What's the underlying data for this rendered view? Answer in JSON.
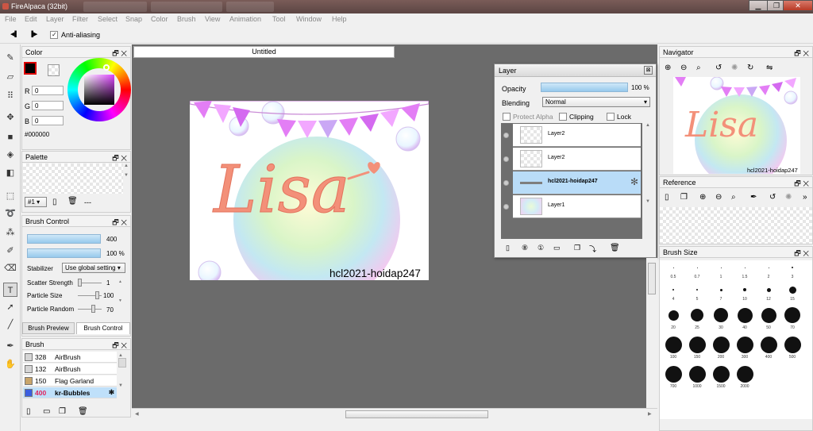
{
  "titlebar": {
    "app_title": "FireAlpaca (32bit)",
    "minimize": "▁",
    "maximize": "❐",
    "close": "✕"
  },
  "menu": [
    "File",
    "Edit",
    "Layer",
    "Filter",
    "Select",
    "Snap",
    "Color",
    "Brush",
    "View",
    "Animation",
    "Tool",
    "Window",
    "Help"
  ],
  "tool_options": {
    "prev_glyph": "◀▌",
    "next_glyph": "▐▶",
    "anti_aliasing_label": "Anti-aliasing",
    "anti_aliasing_checked": true
  },
  "tools": [
    {
      "name": "pen-tool-icon",
      "glyph": "✎"
    },
    {
      "name": "eraser-tool-icon",
      "glyph": "▱"
    },
    {
      "name": "dot-tool-icon",
      "glyph": "⠿"
    },
    {
      "name": "move-tool-icon",
      "glyph": "✥"
    },
    {
      "name": "fill-rect-tool-icon",
      "glyph": "■"
    },
    {
      "name": "bucket-tool-icon",
      "glyph": "◈"
    },
    {
      "name": "gradient-tool-icon",
      "glyph": "◧"
    },
    {
      "name": "select-tool-icon",
      "glyph": "⬚"
    },
    {
      "name": "lasso-tool-icon",
      "glyph": "➰"
    },
    {
      "name": "magic-wand-tool-icon",
      "glyph": "⁂"
    },
    {
      "name": "select-pen-tool-icon",
      "glyph": "✐"
    },
    {
      "name": "select-eraser-tool-icon",
      "glyph": "⌫"
    },
    {
      "name": "text-tool-icon",
      "glyph": "T"
    },
    {
      "name": "operation-tool-icon",
      "glyph": "➚"
    },
    {
      "name": "divide-tool-icon",
      "glyph": "╱"
    },
    {
      "name": "eyedropper-tool-icon",
      "glyph": "✒"
    },
    {
      "name": "hand-tool-icon",
      "glyph": "✋"
    }
  ],
  "color_panel": {
    "title": "Color",
    "r_label": "R",
    "g_label": "G",
    "b_label": "B",
    "r": "0",
    "g": "0",
    "b": "0",
    "hex": "#000000",
    "primary_color": "#000000",
    "secondary_color": "#ff0000"
  },
  "palette_panel": {
    "title": "Palette",
    "selector": "#1",
    "more": "---"
  },
  "brush_control": {
    "title": "Brush Control",
    "size": "400",
    "opacity": "100 %",
    "stabilizer_label": "Stabilizer",
    "stabilizer_value": "Use global setting",
    "scatter_label": "Scatter Strength",
    "scatter_value": "1",
    "particle_size_label": "Particle Size",
    "particle_size_value": "100",
    "particle_random_label": "Particle Random",
    "particle_random_value": "70",
    "tab_preview": "Brush Preview",
    "tab_control": "Brush Control"
  },
  "brush_panel": {
    "title": "Brush",
    "items": [
      {
        "size": "328",
        "name": "AirBrush",
        "color": "#d6d6d6"
      },
      {
        "size": "132",
        "name": "AirBrush",
        "color": "#d6d6d6"
      },
      {
        "size": "150",
        "name": "Flag Garland",
        "color": "#c9a56a"
      },
      {
        "size": "400",
        "name": "kr-Bubbles",
        "color": "#3a5ee0"
      }
    ]
  },
  "document": {
    "tab_title": "Untitled",
    "canvas_text": "Lisa",
    "watermark": "hcl2021-hoidap247"
  },
  "layer_panel": {
    "title": "Layer",
    "opacity_label": "Opacity",
    "opacity_value": "100 %",
    "blending_label": "Blending",
    "blending_value": "Normal",
    "protect_alpha_label": "Protect Alpha",
    "clipping_label": "Clipping",
    "lock_label": "Lock",
    "layers": [
      {
        "name": "Layer2",
        "selected": false
      },
      {
        "name": "Layer2",
        "selected": false
      },
      {
        "name": "hcl2021-hoidap247",
        "selected": true
      },
      {
        "name": "Layer1",
        "selected": false
      }
    ]
  },
  "navigator": {
    "title": "Navigator",
    "preview_text": "Lisa",
    "preview_watermark": "hcl2021-hoidap247"
  },
  "reference": {
    "title": "Reference"
  },
  "brush_size_panel": {
    "title": "Brush Size",
    "sizes": [
      {
        "label": "0.5",
        "dot": 1
      },
      {
        "label": "0.7",
        "dot": 1
      },
      {
        "label": "1",
        "dot": 1
      },
      {
        "label": "1.5",
        "dot": 1
      },
      {
        "label": "2",
        "dot": 1
      },
      {
        "label": "3",
        "dot": 2
      },
      {
        "label": "4",
        "dot": 2
      },
      {
        "label": "5",
        "dot": 2
      },
      {
        "label": "7",
        "dot": 3
      },
      {
        "label": "10",
        "dot": 4
      },
      {
        "label": "12",
        "dot": 5
      },
      {
        "label": "15",
        "dot": 9
      },
      {
        "label": "20",
        "dot": 13
      },
      {
        "label": "25",
        "dot": 16
      },
      {
        "label": "30",
        "dot": 18
      },
      {
        "label": "40",
        "dot": 19
      },
      {
        "label": "50",
        "dot": 19
      },
      {
        "label": "70",
        "dot": 20
      },
      {
        "label": "100",
        "dot": 21
      },
      {
        "label": "150",
        "dot": 21
      },
      {
        "label": "200",
        "dot": 21
      },
      {
        "label": "300",
        "dot": 21
      },
      {
        "label": "400",
        "dot": 21
      },
      {
        "label": "500",
        "dot": 21
      },
      {
        "label": "700",
        "dot": 21
      },
      {
        "label": "1000",
        "dot": 21
      },
      {
        "label": "1500",
        "dot": 21
      },
      {
        "label": "2000",
        "dot": 21
      }
    ]
  }
}
